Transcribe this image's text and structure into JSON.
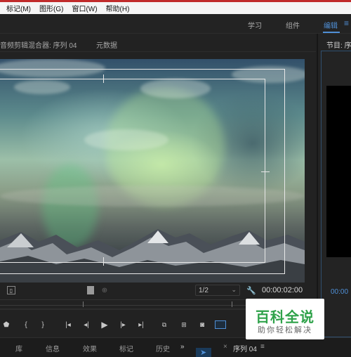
{
  "menubar": {
    "items": [
      "标记(M)",
      "图形(G)",
      "窗口(W)",
      "帮助(H)"
    ]
  },
  "workspace": {
    "tabs": [
      "学习",
      "组件",
      "编辑"
    ],
    "active": "编辑",
    "menu_icon": "≡"
  },
  "source_panel": {
    "tabs": [
      "音频剪辑混合器: 序列 04",
      "元数据"
    ],
    "resolution": "1/2",
    "timecode": "00:00:02:00"
  },
  "program_panel": {
    "tab": "节目: 序列",
    "timecode": "00:00"
  },
  "bottom_panel": {
    "tabs": [
      "库",
      "信息",
      "效果",
      "标记",
      "历史"
    ],
    "overflow": "»",
    "timeline_close": "×",
    "timeline_tab": "序列 04",
    "timeline_menu": "≡"
  },
  "watermark": {
    "title": "百科全说",
    "subtitle": "助你轻松解决"
  },
  "colors": {
    "accent": "#4f8fd6",
    "brand_green": "#2fa24a",
    "menubar_top": "#c12b2b"
  }
}
